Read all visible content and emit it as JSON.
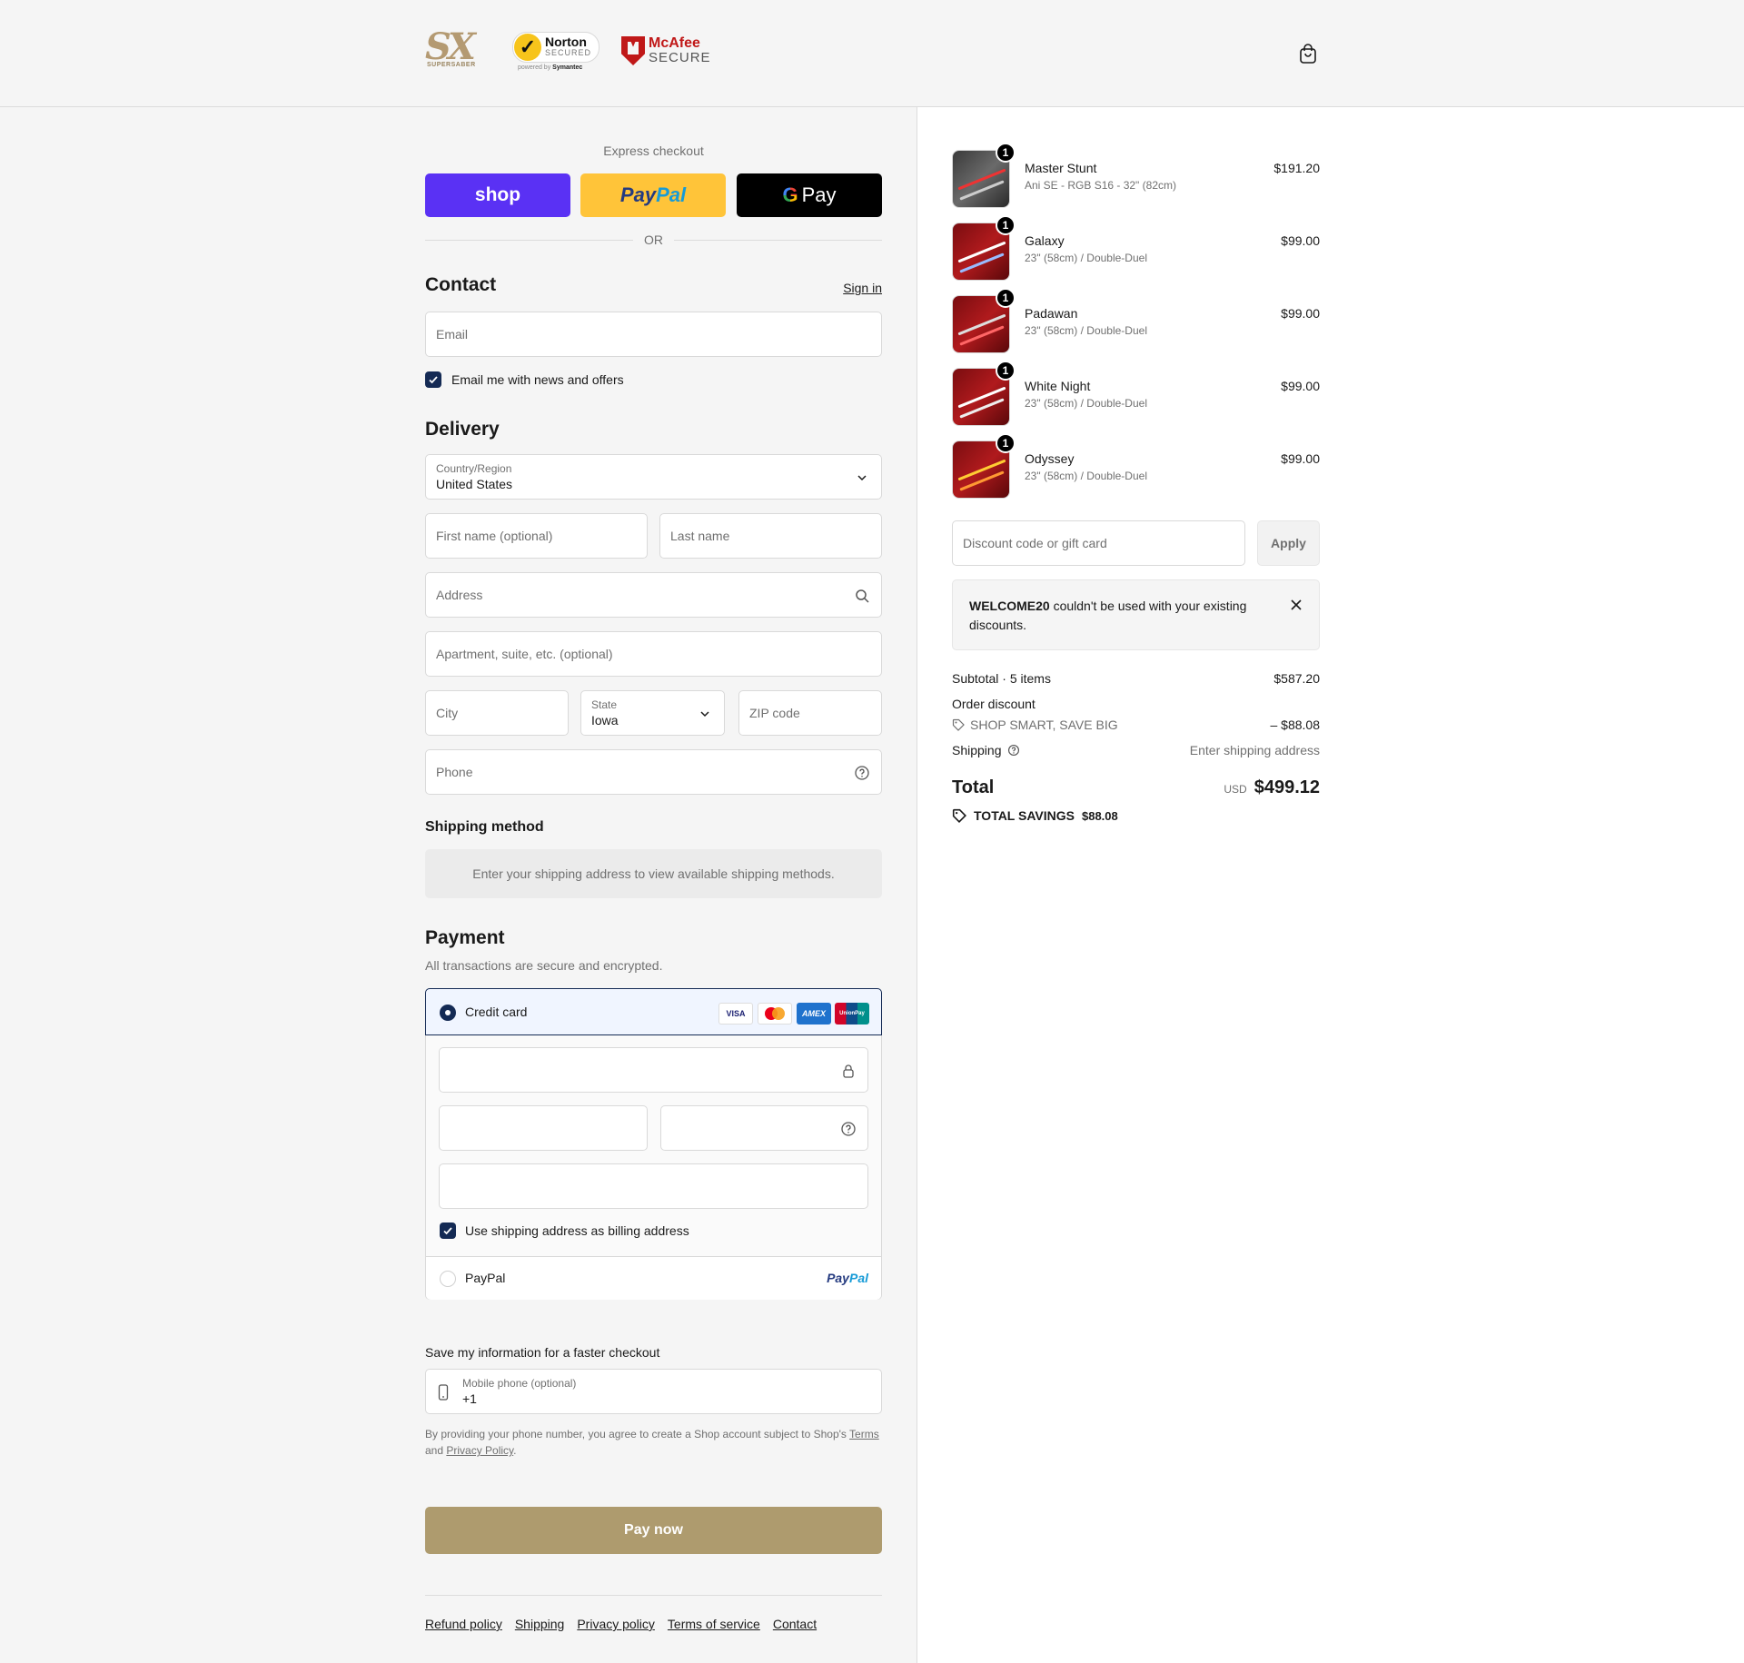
{
  "header": {
    "logo_sx_text": "SX",
    "logo_sx_sub": "SUPERSABER",
    "norton_title": "Norton",
    "norton_secured": "SECURED",
    "norton_by_prefix": "powered by",
    "norton_by_brand": "Symantec",
    "mcafee_1": "McAfee",
    "mcafee_2": "SECURE",
    "cart_icon": "shopping-bag-icon"
  },
  "express": {
    "title": "Express checkout",
    "shop_label": "shop",
    "paypal_1": "Pay",
    "paypal_2": "Pal",
    "gpay_g": "G",
    "gpay_label": "Pay",
    "or_label": "OR"
  },
  "contact": {
    "title": "Contact",
    "sign_in": "Sign in",
    "email_placeholder": "Email",
    "newsletter_label": "Email me with news and offers",
    "newsletter_checked": true
  },
  "delivery": {
    "title": "Delivery",
    "country_label": "Country/Region",
    "country_value": "United States",
    "first_name_placeholder": "First name (optional)",
    "last_name_placeholder": "Last name",
    "address_placeholder": "Address",
    "apartment_placeholder": "Apartment, suite, etc. (optional)",
    "city_placeholder": "City",
    "state_label": "State",
    "state_value": "Iowa",
    "zip_placeholder": "ZIP code",
    "phone_placeholder": "Phone"
  },
  "shipping_method": {
    "title": "Shipping method",
    "info": "Enter your shipping address to view available shipping methods."
  },
  "payment": {
    "title": "Payment",
    "subtitle": "All transactions are secure and encrypted.",
    "credit_card_label": "Credit card",
    "cards": [
      "VISA",
      "",
      "AMEX",
      "UnionPay"
    ],
    "billing_label": "Use shipping address as billing address",
    "billing_checked": true,
    "paypal_label": "PayPal",
    "paypal_logo_1": "Pay",
    "paypal_logo_2": "Pal"
  },
  "save_info": {
    "title": "Save my information for a faster checkout",
    "mobile_label": "Mobile phone (optional)",
    "mobile_value": "+1",
    "disclaimer_1": "By providing your phone number, you agree to create a Shop account subject to Shop's ",
    "terms": "Terms",
    "disclaimer_2": "and ",
    "privacy": "Privacy Policy",
    "disclaimer_3": "."
  },
  "pay_now": "Pay now",
  "footer": [
    "Refund policy",
    "Shipping",
    "Privacy policy",
    "Terms of service",
    "Contact"
  ],
  "cart": {
    "items": [
      {
        "name": "Master Stunt",
        "variant": "Ani SE - RGB S16 - 32\" (82cm)",
        "price": "$191.20",
        "qty": "1"
      },
      {
        "name": "Galaxy",
        "variant": "23\" (58cm) / Double-Duel",
        "price": "$99.00",
        "qty": "1"
      },
      {
        "name": "Padawan",
        "variant": "23\" (58cm) / Double-Duel",
        "price": "$99.00",
        "qty": "1"
      },
      {
        "name": "White Night",
        "variant": "23\" (58cm) / Double-Duel",
        "price": "$99.00",
        "qty": "1"
      },
      {
        "name": "Odyssey",
        "variant": "23\" (58cm) / Double-Duel",
        "price": "$99.00",
        "qty": "1"
      }
    ],
    "discount_placeholder": "Discount code or gift card",
    "apply_label": "Apply",
    "notice_code": "WELCOME20",
    "notice_text": " couldn't be used with your existing discounts.",
    "subtotal_label": "Subtotal · 5 items",
    "subtotal_value": "$587.20",
    "order_discount_label": "Order discount",
    "discount_name": "SHOP SMART, SAVE BIG",
    "discount_value": "– $88.08",
    "shipping_label": "Shipping",
    "shipping_value": "Enter shipping address",
    "total_label": "Total",
    "currency": "USD",
    "total_value": "$499.12",
    "savings_label": "TOTAL SAVINGS",
    "savings_value": "$88.08"
  },
  "colors": {
    "accent": "#142a54",
    "pay_now": "#ae9b6e",
    "shop": "#5a31f4",
    "paypal": "#ffc439"
  }
}
